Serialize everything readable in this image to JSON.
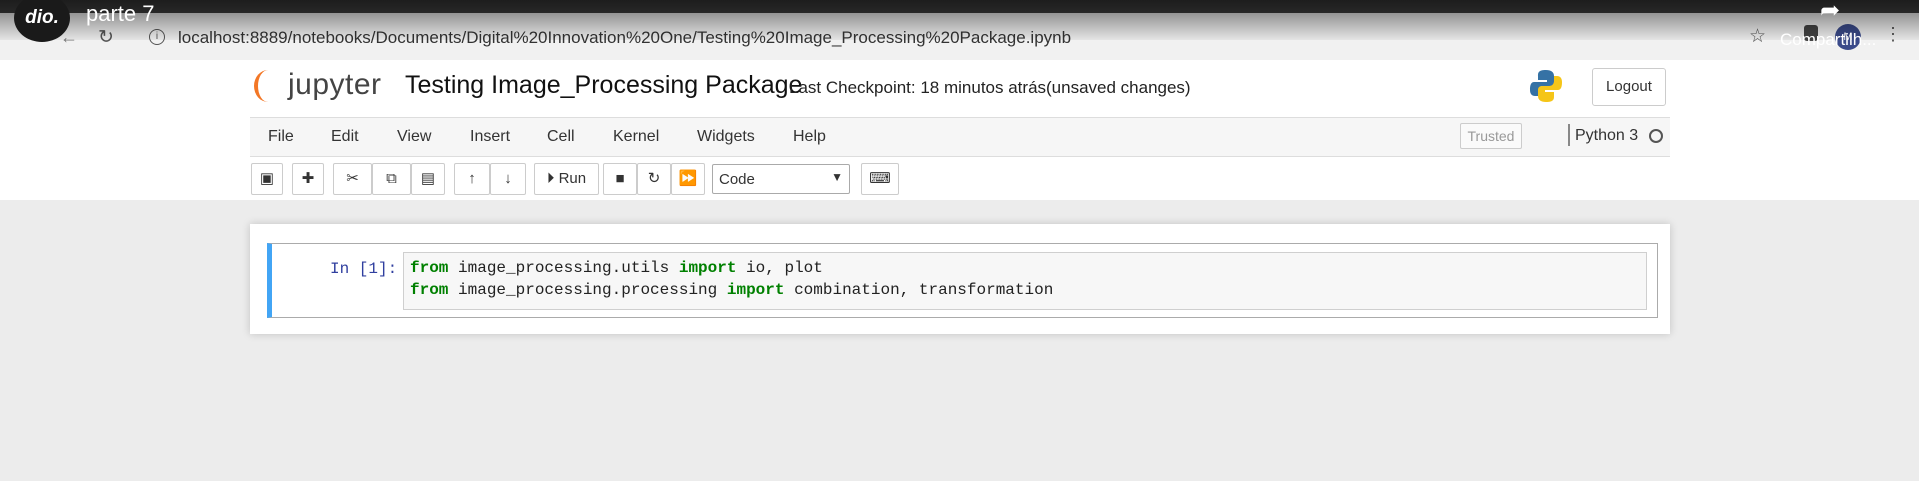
{
  "video": {
    "title": "parte 7",
    "channel_logo": "dio.",
    "share_label": "Compartilh..."
  },
  "browser": {
    "url": "localhost:8889/notebooks/Documents/Digital%20Innovation%20One/Testing%20Image_Processing%20Package.ipynb",
    "icons": [
      "back-arrow-icon",
      "reload-icon",
      "info-icon",
      "star-icon",
      "extensions-icon",
      "profile-avatar",
      "menu-dots-icon"
    ]
  },
  "header": {
    "logo_text": "jupyter",
    "notebook_name": "Testing Image_Processing Package",
    "checkpoint": "Last Checkpoint: 18 minutos atrás",
    "unsaved": "(unsaved changes)",
    "logout": "Logout"
  },
  "menubar": {
    "items": [
      "File",
      "Edit",
      "View",
      "Insert",
      "Cell",
      "Kernel",
      "Widgets",
      "Help"
    ],
    "trusted": "Trusted",
    "kernel": "Python 3"
  },
  "toolbar": {
    "run_label": "Run",
    "cell_type": "Code"
  },
  "cell": {
    "prompt": "In [1]:",
    "line1": {
      "kw1": "from",
      "mod": " image_processing.utils ",
      "kw2": "import",
      "rest": " io, plot"
    },
    "line2": {
      "kw1": "from",
      "mod": " image_processing.processing ",
      "kw2": "import",
      "rest": " combination, transformation"
    }
  },
  "colors": {
    "jupyter_orange": "#f37726",
    "cell_selected": "#42a5f5",
    "keyword": "#008000",
    "prompt": "#303f9f"
  }
}
